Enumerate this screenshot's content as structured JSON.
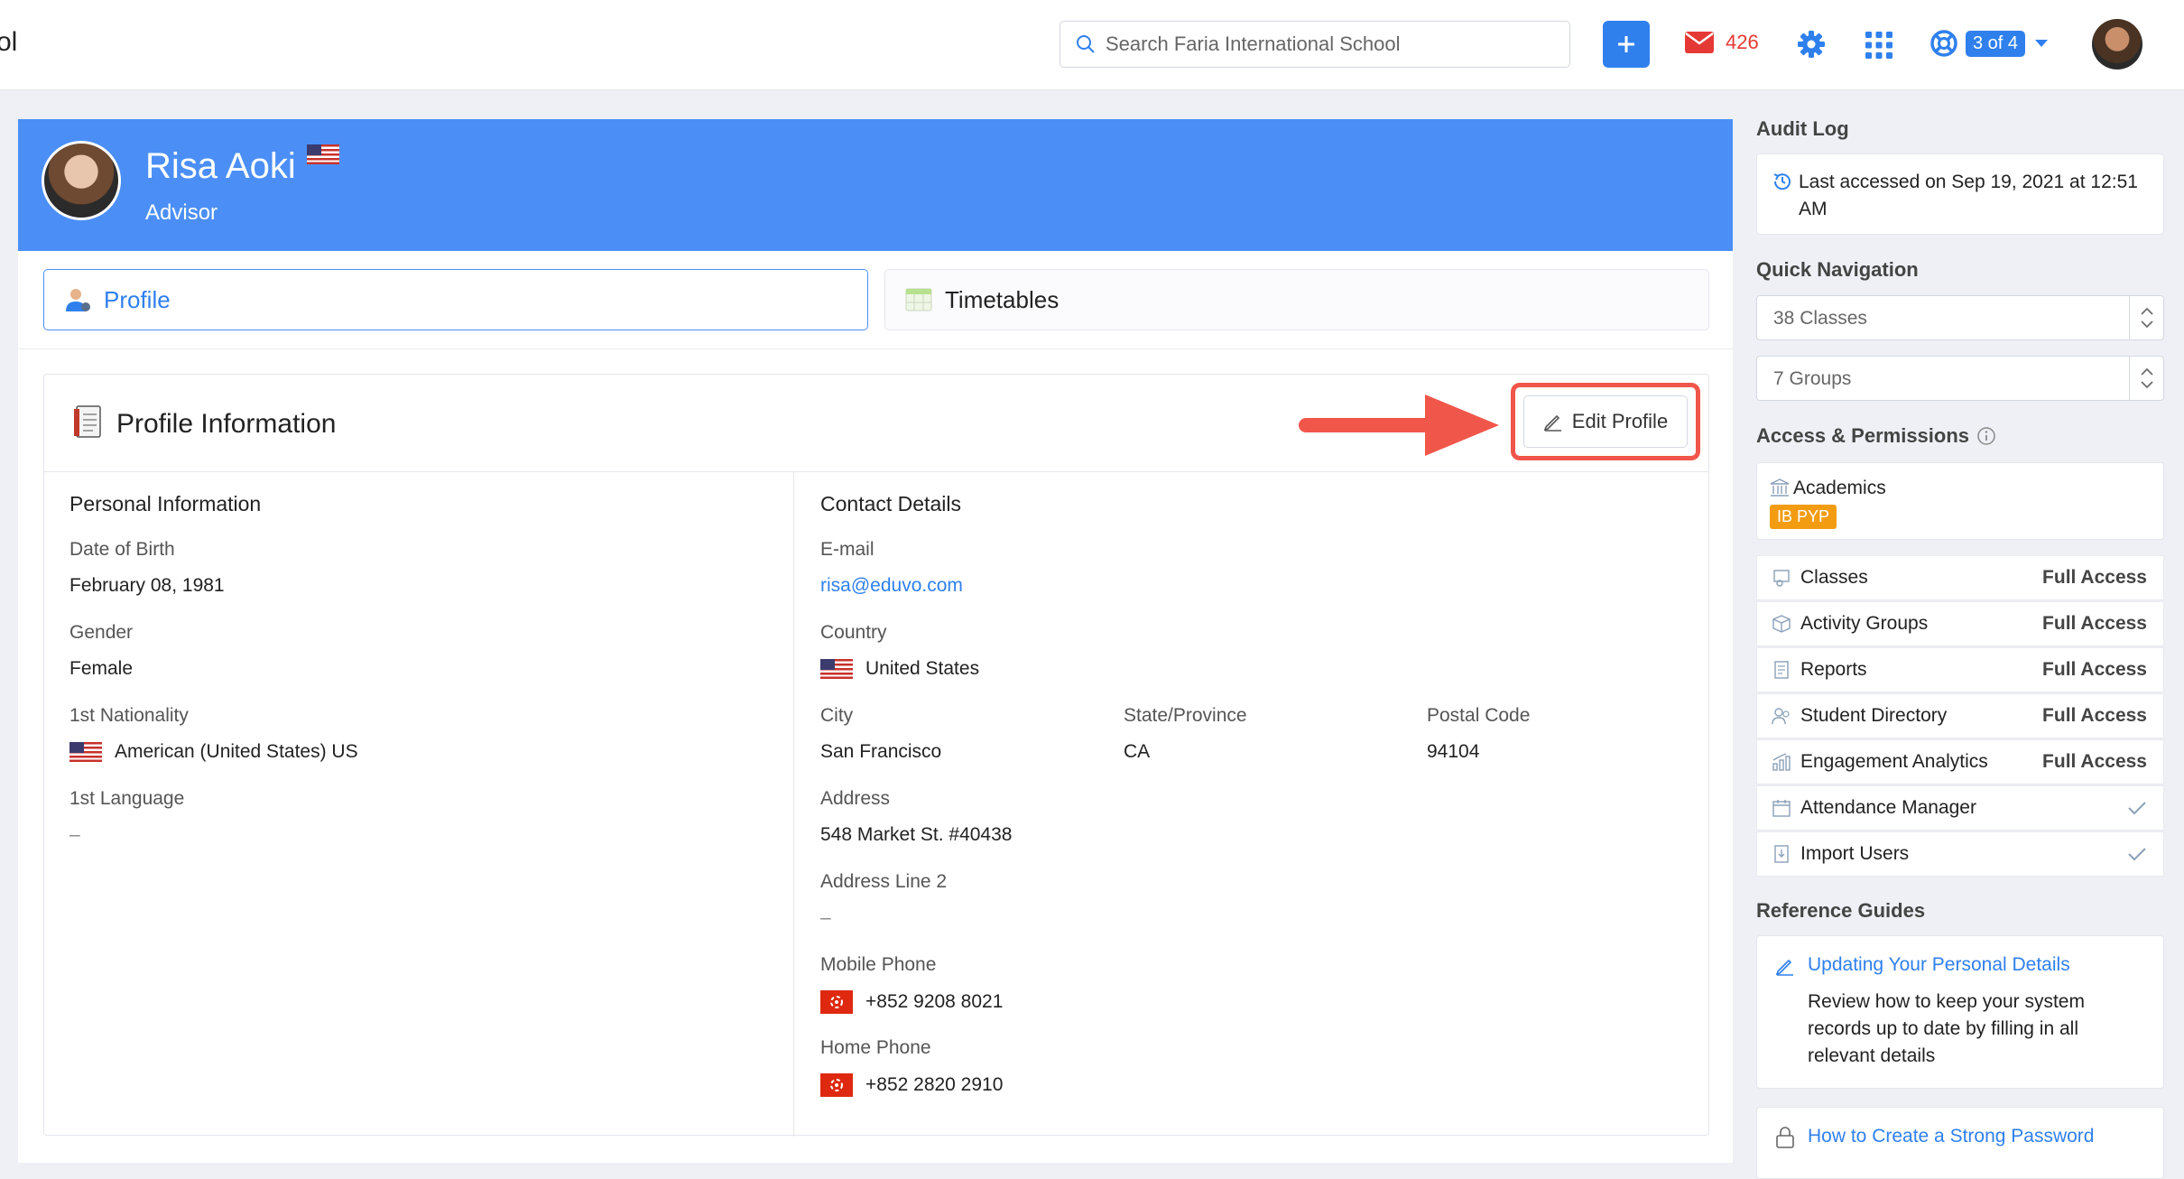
{
  "topbar": {
    "brand_fragment": "ol",
    "search_placeholder": "Search Faria International School",
    "mail_count": "426",
    "support_badge": "3 of 4"
  },
  "hero": {
    "name": "Risa Aoki",
    "role": "Advisor"
  },
  "tabs": [
    {
      "label": "Profile",
      "active": true
    },
    {
      "label": "Timetables",
      "active": false
    }
  ],
  "profile_card": {
    "title": "Profile Information",
    "edit_label": "Edit Profile",
    "personal": {
      "title": "Personal Information",
      "dob_label": "Date of Birth",
      "dob": "February 08, 1981",
      "gender_label": "Gender",
      "gender": "Female",
      "nationality_label": "1st Nationality",
      "nationality": "American (United States) US",
      "language_label": "1st Language",
      "language": "–"
    },
    "contact": {
      "title": "Contact Details",
      "email_label": "E-mail",
      "email": "risa@eduvo.com",
      "country_label": "Country",
      "country": "United States",
      "city_label": "City",
      "city": "San Francisco",
      "state_label": "State/Province",
      "state": "CA",
      "postal_label": "Postal Code",
      "postal": "94104",
      "address_label": "Address",
      "address": "548 Market St. #40438",
      "address2_label": "Address Line 2",
      "address2": "–",
      "mobile_label": "Mobile Phone",
      "mobile": "+852 9208 8021",
      "home_label": "Home Phone",
      "home": "+852 2820 2910"
    }
  },
  "sidebar": {
    "audit_title": "Audit Log",
    "audit_text": "Last accessed on Sep 19, 2021 at 12:51 AM",
    "quicknav_title": "Quick Navigation",
    "classes_select": "38 Classes",
    "groups_select": "7 Groups",
    "access_title": "Access & Permissions",
    "academics_label": "Academics",
    "academics_badge": "IB PYP",
    "permissions": [
      {
        "name": "Classes",
        "value": "Full Access"
      },
      {
        "name": "Activity Groups",
        "value": "Full Access"
      },
      {
        "name": "Reports",
        "value": "Full Access"
      },
      {
        "name": "Student Directory",
        "value": "Full Access"
      },
      {
        "name": "Engagement Analytics",
        "value": "Full Access"
      },
      {
        "name": "Attendance Manager",
        "value": ""
      },
      {
        "name": "Import Users",
        "value": ""
      }
    ],
    "guides_title": "Reference Guides",
    "guide1_title": "Updating Your Personal Details",
    "guide1_desc": "Review how to keep your system records up to date by filling in all relevant details",
    "guide2_title": "How to Create a Strong Password"
  },
  "colors": {
    "accent": "#2f80ed",
    "hero": "#4b8ff6",
    "mail": "#e53935",
    "highlight": "#f0564a",
    "badge": "#f39c12"
  }
}
